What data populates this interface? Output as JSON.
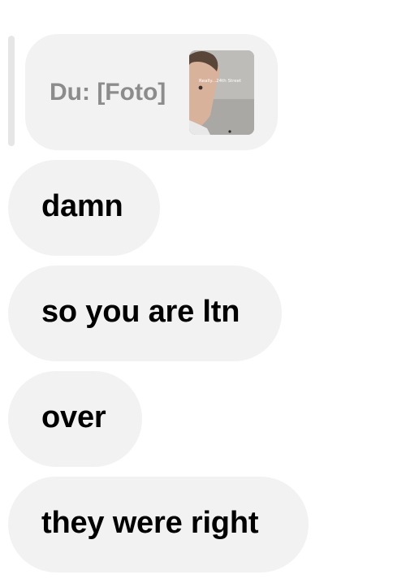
{
  "reply": {
    "prefix_text": "Du: [Foto]",
    "thumbnail_caption": "Really...24th Street"
  },
  "messages": [
    {
      "text": "damn"
    },
    {
      "text": "so you are ltn"
    },
    {
      "text": "over"
    },
    {
      "text": "they were right"
    }
  ],
  "colors": {
    "bubble_background": "#f2f2f2",
    "reply_text": "#8c8c8c",
    "message_text": "#000000"
  }
}
